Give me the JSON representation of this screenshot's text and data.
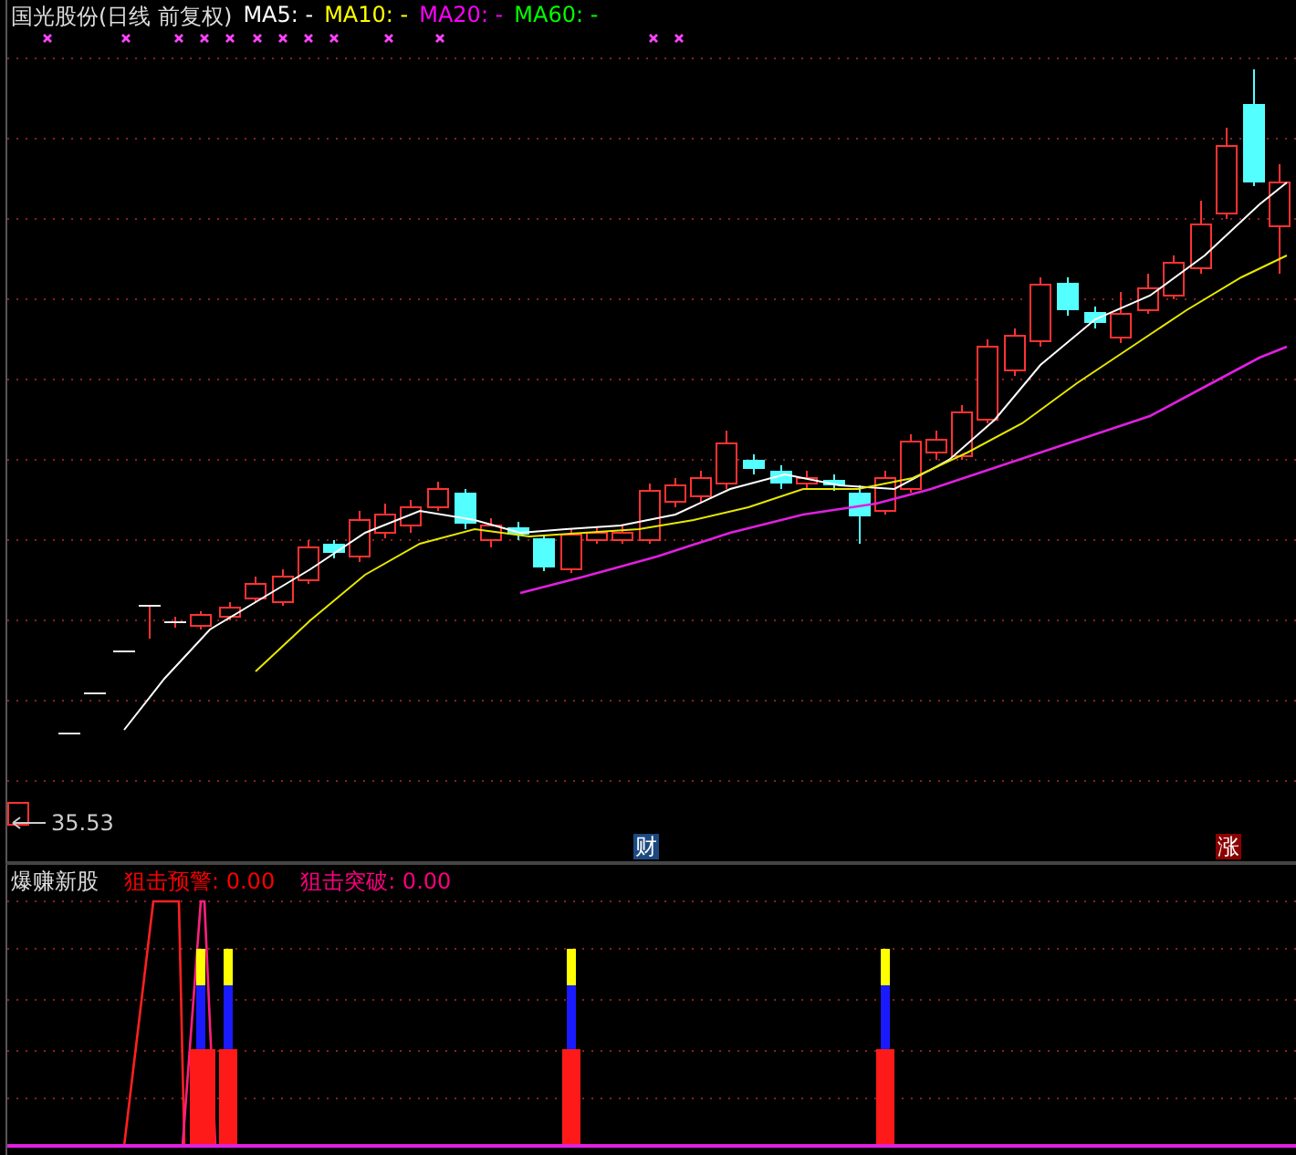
{
  "header": {
    "title": "国光股份(日线 前复权)",
    "indicators": [
      {
        "label": "MA5: -",
        "color": "#ffffff"
      },
      {
        "label": "MA10: -",
        "color": "#ffff00"
      },
      {
        "label": "MA20: -",
        "color": "#ff00ff"
      },
      {
        "label": "MA60: -",
        "color": "#00ff00"
      }
    ]
  },
  "price_chart": {
    "low_label": "35.53",
    "markers": [
      {
        "text": "财",
        "kind": "finance"
      },
      {
        "text": "涨",
        "kind": "rise"
      }
    ]
  },
  "sub_chart": {
    "title": "爆赚新股",
    "indicators": [
      {
        "label": "狙击预警: 0.00",
        "color": "#ff0000"
      },
      {
        "label": "狙击突破: 0.00",
        "color": "#ff0080"
      }
    ]
  }
}
